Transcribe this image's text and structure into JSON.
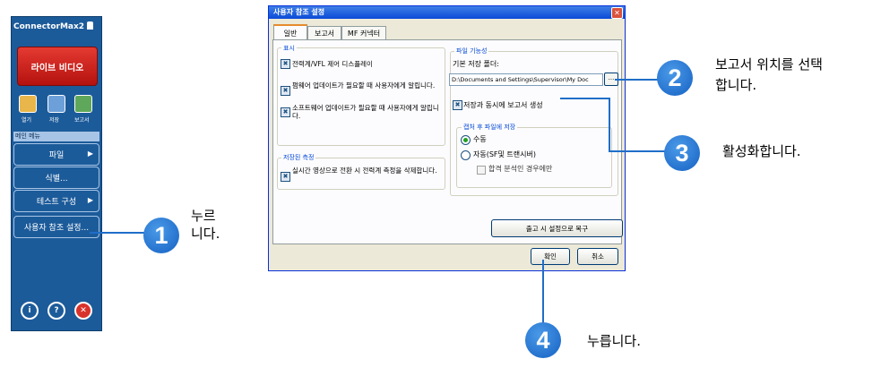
{
  "sidebar": {
    "app_title": "ConnectorMax2",
    "live_button": "라이브 비디오",
    "tools": [
      {
        "label": "열기",
        "icon": "folder-icon"
      },
      {
        "label": "저장",
        "icon": "save-icon"
      },
      {
        "label": "보고서",
        "icon": "report-icon"
      }
    ],
    "menu_header": "메인 메뉴",
    "menu_items": [
      {
        "label": "파일",
        "arrow": "▶"
      },
      {
        "label": "식별...",
        "arrow": ""
      },
      {
        "label": "테스트 구성",
        "arrow": "▶"
      },
      {
        "label": "사용자 참조 설정...",
        "arrow": ""
      }
    ],
    "bottom_icons": [
      "info-icon",
      "help-icon",
      "exit-icon"
    ]
  },
  "dialog": {
    "title": "사용자 참조 설정",
    "close_glyph": "✕",
    "tabs": [
      "일반",
      "보고서",
      "MF 커넥터"
    ],
    "active_tab": "일반",
    "display_group": {
      "label": "표시",
      "options": [
        {
          "text": "전력계/VFL 제어 디스플레이",
          "checked": true
        },
        {
          "text": "펌웨어 업데이트가 필요할 때 사용자에게 알립니다.",
          "checked": true
        },
        {
          "text": "소프트웨어 업데이트가 필요할 때 사용자에게 알립니다.",
          "checked": true
        }
      ]
    },
    "saved_group": {
      "label": "저장된 측정",
      "option": {
        "text": "실시간 영상으로 전환 시 전력계 측정을 삭제합니다.",
        "checked": true
      }
    },
    "file_group": {
      "label": "파일 기능성",
      "default_folder_label": "기본 저장 폴더:",
      "default_folder_value": "D:\\Documents and Settings\\Supervisor\\My Doc",
      "browse_label": "...",
      "report_option": {
        "text": "저장과 동시에 보고서 생성",
        "checked": true
      },
      "on_save_group": {
        "label": "캡처 후 파일에 저장",
        "radios": [
          {
            "text": "수동",
            "selected": true
          },
          {
            "text": "자동(SF및 트랜시버)",
            "selected": false
          }
        ],
        "pass_only": {
          "text": "합격 분석인 경우에만",
          "checked": false
        }
      }
    },
    "restore_button": "출고 시 설정으로 복구",
    "ok_button": "확인",
    "cancel_button": "취소"
  },
  "callouts": [
    {
      "number": "1",
      "text_line1": "누르",
      "text_line2": "니다."
    },
    {
      "number": "2",
      "text_line1": "보고서 위치를 선택",
      "text_line2": "합니다."
    },
    {
      "number": "3",
      "text_line1": "활성화합니다.",
      "text_line2": ""
    },
    {
      "number": "4",
      "text_line1": "누릅니다.",
      "text_line2": ""
    }
  ],
  "colors": {
    "sidebar_bg": "#1c5b9a",
    "live_button": "#d12a22",
    "callout_blue": "#1f6ec8",
    "dialog_title": "#0a4ad8"
  }
}
